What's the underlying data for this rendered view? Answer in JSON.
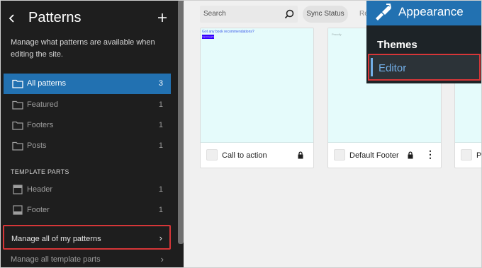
{
  "sidebar": {
    "title": "Patterns",
    "back_icon": "chevron-left-icon",
    "add_icon": "plus-icon",
    "description": "Manage what patterns are available when editing the site.",
    "items": [
      {
        "label": "All patterns",
        "count": "3",
        "icon": "folder-icon",
        "active": true
      },
      {
        "label": "Featured",
        "count": "1",
        "icon": "folder-icon"
      },
      {
        "label": "Footers",
        "count": "1",
        "icon": "folder-icon"
      },
      {
        "label": "Posts",
        "count": "1",
        "icon": "folder-icon"
      }
    ],
    "template_parts_heading": "TEMPLATE PARTS",
    "template_parts": [
      {
        "label": "Header",
        "count": "1",
        "icon": "header-icon"
      },
      {
        "label": "Footer",
        "count": "1",
        "icon": "footer-icon"
      }
    ],
    "manage_patterns_label": "Manage all of my patterns",
    "manage_parts_label": "Manage all template parts"
  },
  "toolbar": {
    "search_placeholder": "Search",
    "sync_label": "Sync Status",
    "reset_label": "Re"
  },
  "cards": [
    {
      "title": "Call to action",
      "preview_text": "Got any book recommendations?",
      "preview_button": "Get in touch"
    },
    {
      "title": "Default Footer",
      "preview_text": "Proudly"
    },
    {
      "title": "Po"
    }
  ],
  "admin_menu": {
    "section": "Appearance",
    "section_icon": "paintbrush-icon",
    "items": [
      "Themes",
      "Editor"
    ],
    "accent": "#2271b1",
    "highlight": "#d63638"
  }
}
